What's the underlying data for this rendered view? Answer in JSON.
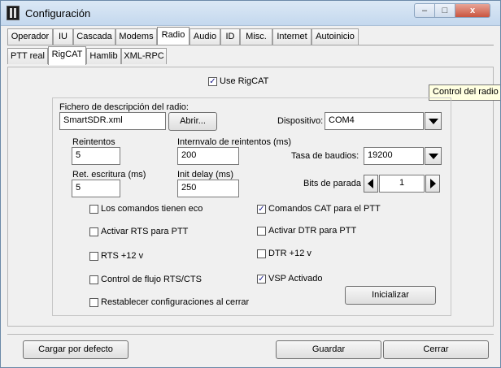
{
  "window": {
    "title": "Configuración",
    "close_label": "x",
    "min_label": "–",
    "max_label": "□"
  },
  "tabs_main": [
    "Operador",
    "IU",
    "Cascada",
    "Modems",
    "Radio",
    "Audio",
    "ID",
    "Misc.",
    "Internet",
    "Autoinicio"
  ],
  "tabs_sub": [
    "PTT real",
    "RigCAT",
    "Hamlib",
    "XML-RPC"
  ],
  "use_rigcat": {
    "label": "Use RigCAT",
    "checked": true
  },
  "tooltip": "Control del radio u",
  "descriptor": {
    "label": "Fichero de descripción del radio:",
    "value": "SmartSDR.xml",
    "open_button": "Abrir..."
  },
  "device": {
    "label": "Dispositivo:",
    "value": "COM4"
  },
  "retries": {
    "label": "Reintentos",
    "value": "5"
  },
  "retry_interval": {
    "label": "Internvalo de reintentos (ms)",
    "value": "200"
  },
  "baud": {
    "label": "Tasa de baudios:",
    "value": "19200"
  },
  "write_delay": {
    "label": "Ret. escritura (ms)",
    "value": "5"
  },
  "init_delay": {
    "label": "Init delay (ms)",
    "value": "250"
  },
  "stop_bits": {
    "label": "Bits de parada",
    "value": "1"
  },
  "checks": {
    "echo": {
      "label": "Los comandos tienen eco",
      "checked": false
    },
    "cat_ptt": {
      "label": "Comandos CAT para el PTT",
      "checked": true
    },
    "rts_ptt": {
      "label": "Activar RTS para PTT",
      "checked": false
    },
    "dtr_ptt": {
      "label": "Activar DTR para PTT",
      "checked": false
    },
    "rts12": {
      "label": "RTS +12 v",
      "checked": false
    },
    "dtr12": {
      "label": "DTR +12 v",
      "checked": false
    },
    "flow": {
      "label": "Control de flujo RTS/CTS",
      "checked": false
    },
    "vsp": {
      "label": "VSP Activado",
      "checked": true
    },
    "restore": {
      "label": "Restablecer configuraciones al cerrar",
      "checked": false
    }
  },
  "init_button": "Inicializar",
  "bottom": {
    "defaults": "Cargar por defecto",
    "save": "Guardar",
    "cancel": "Cerrar"
  }
}
